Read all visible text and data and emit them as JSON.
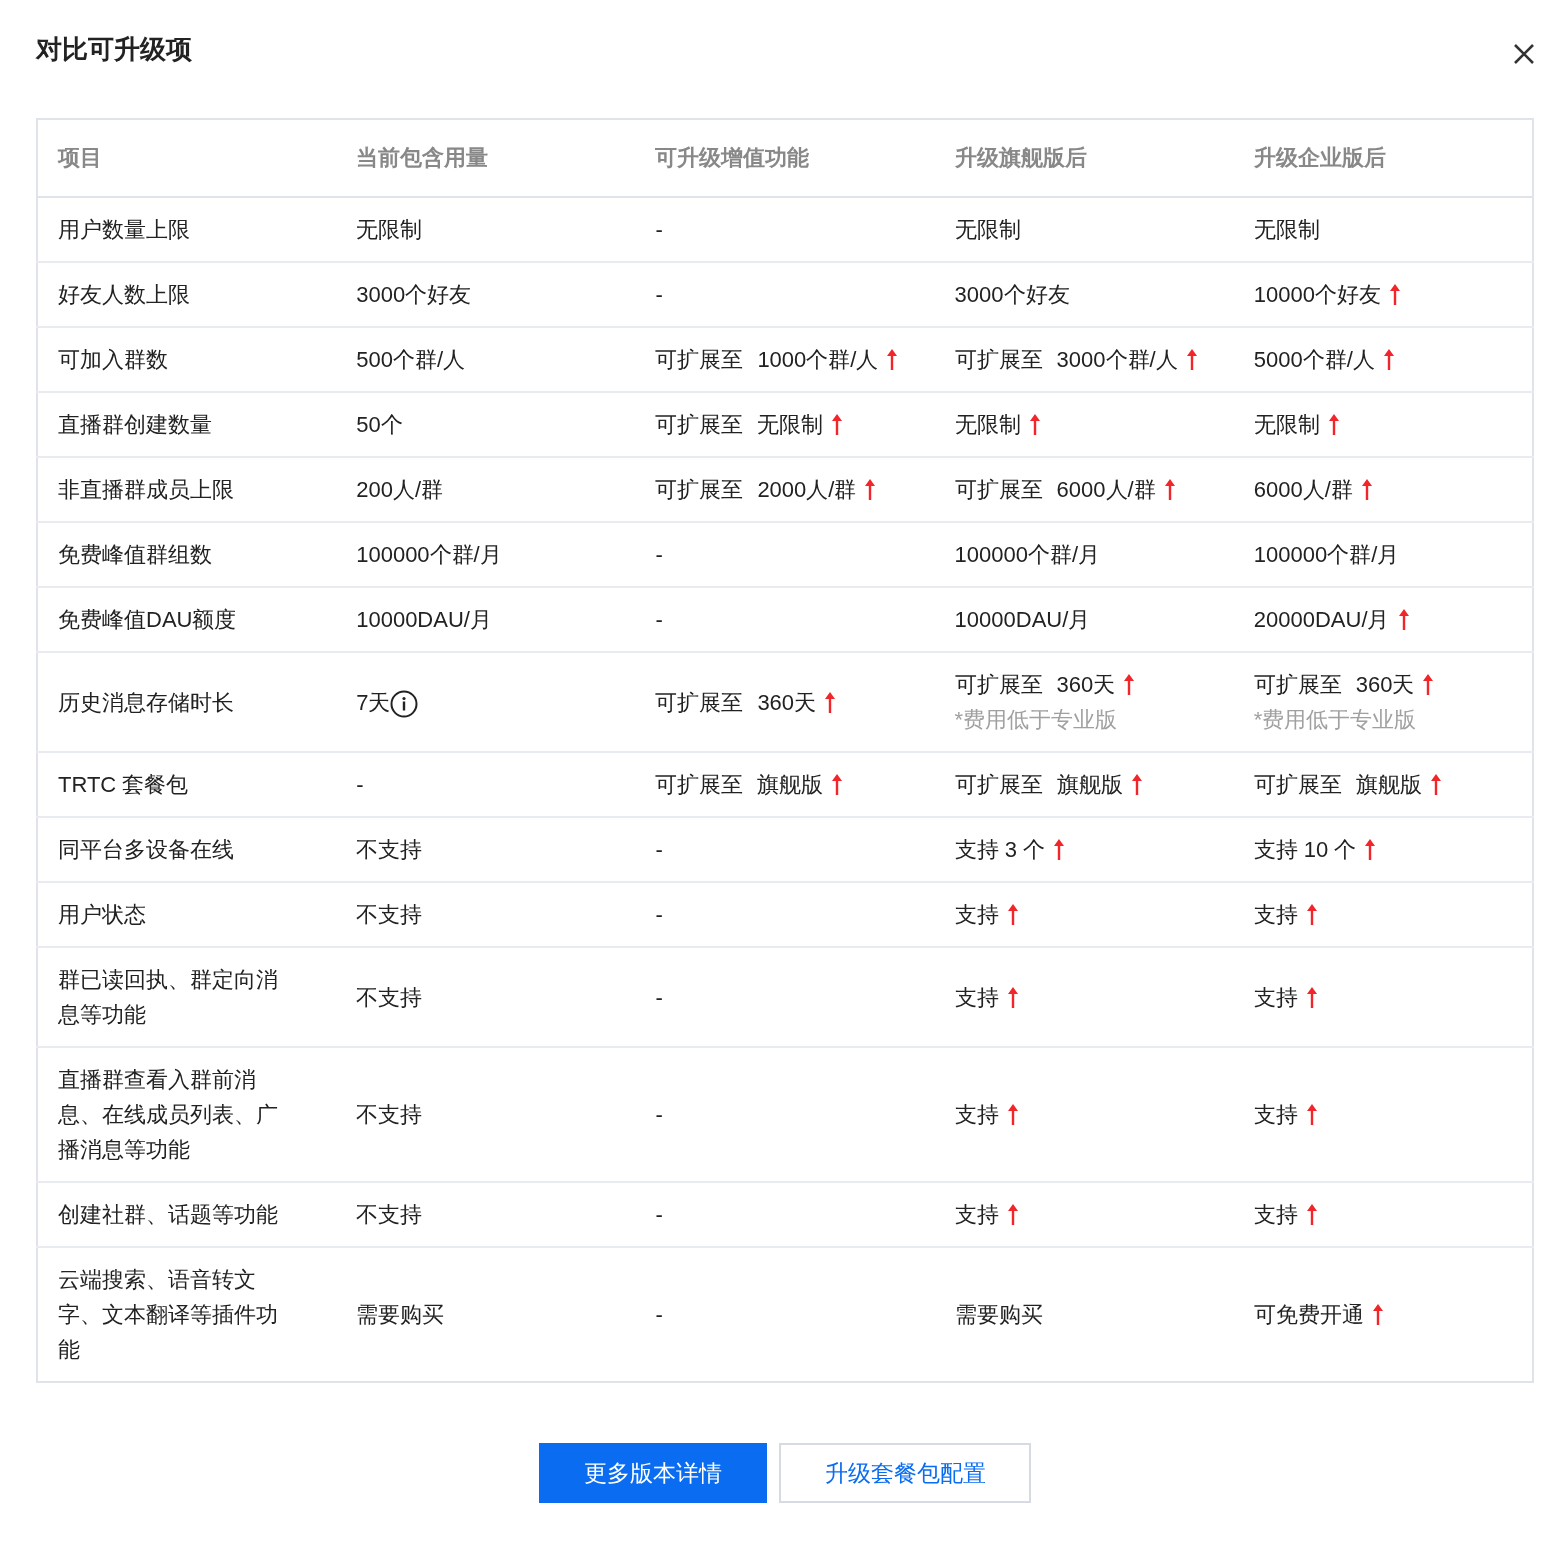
{
  "dialog": {
    "title": "对比可升级项"
  },
  "table": {
    "columns": [
      "项目",
      "当前包含用量",
      "可升级增值功能",
      "升级旗舰版后",
      "升级企业版后"
    ],
    "rows": [
      [
        {
          "text": "用户数量上限",
          "up": false
        },
        {
          "text": "无限制",
          "up": false
        },
        {
          "text": "-",
          "up": false
        },
        {
          "text": "无限制",
          "up": false
        },
        {
          "text": "无限制",
          "up": false
        }
      ],
      [
        {
          "text": "好友人数上限",
          "up": false
        },
        {
          "text": "3000个好友",
          "up": false
        },
        {
          "text": "-",
          "up": false
        },
        {
          "text": "3000个好友",
          "up": false
        },
        {
          "text": "10000个好友",
          "up": true
        }
      ],
      [
        {
          "text": "可加入群数",
          "up": false
        },
        {
          "text": "500个群/人",
          "up": false
        },
        {
          "prefix": "可扩展至",
          "text": "1000个群/人",
          "up": true
        },
        {
          "prefix": "可扩展至",
          "text": "3000个群/人",
          "up": true
        },
        {
          "text": "5000个群/人",
          "up": true
        }
      ],
      [
        {
          "text": "直播群创建数量",
          "up": false
        },
        {
          "text": "50个",
          "up": false
        },
        {
          "prefix": "可扩展至",
          "text": "无限制",
          "up": true
        },
        {
          "text": "无限制",
          "up": true
        },
        {
          "text": "无限制",
          "up": true
        }
      ],
      [
        {
          "text": "非直播群成员上限",
          "up": false
        },
        {
          "text": "200人/群",
          "up": false
        },
        {
          "prefix": "可扩展至",
          "text": "2000人/群",
          "up": true
        },
        {
          "prefix": "可扩展至",
          "text": "6000人/群",
          "up": true
        },
        {
          "text": "6000人/群",
          "up": true
        }
      ],
      [
        {
          "text": "免费峰值群组数",
          "up": false
        },
        {
          "text": "100000个群/月",
          "up": false
        },
        {
          "text": "-",
          "up": false
        },
        {
          "text": "100000个群/月",
          "up": false
        },
        {
          "text": "100000个群/月",
          "up": false
        }
      ],
      [
        {
          "text": "免费峰值DAU额度",
          "up": false
        },
        {
          "text": "10000DAU/月",
          "up": false
        },
        {
          "text": "-",
          "up": false
        },
        {
          "text": "10000DAU/月",
          "up": false
        },
        {
          "text": "20000DAU/月",
          "up": true
        }
      ],
      [
        {
          "text": "历史消息存储时长",
          "up": false
        },
        {
          "text": "7天",
          "up": false,
          "info": true
        },
        {
          "prefix": "可扩展至",
          "text": "360天",
          "up": true
        },
        {
          "prefix": "可扩展至",
          "text": "360天",
          "up": true,
          "note": "*费用低于专业版"
        },
        {
          "prefix": "可扩展至",
          "text": "360天",
          "up": true,
          "note": "*费用低于专业版"
        }
      ],
      [
        {
          "text": "TRTC 套餐包",
          "up": false
        },
        {
          "text": "-",
          "up": false
        },
        {
          "prefix": "可扩展至",
          "text": "旗舰版",
          "up": true
        },
        {
          "prefix": "可扩展至",
          "text": "旗舰版",
          "up": true
        },
        {
          "prefix": "可扩展至",
          "text": "旗舰版",
          "up": true
        }
      ],
      [
        {
          "text": "同平台多设备在线",
          "up": false
        },
        {
          "text": "不支持",
          "up": false
        },
        {
          "text": "-",
          "up": false
        },
        {
          "text": "支持 3 个",
          "up": true
        },
        {
          "text": "支持 10 个",
          "up": true
        }
      ],
      [
        {
          "text": "用户状态",
          "up": false
        },
        {
          "text": "不支持",
          "up": false
        },
        {
          "text": "-",
          "up": false
        },
        {
          "text": "支持",
          "up": true
        },
        {
          "text": "支持",
          "up": true
        }
      ],
      [
        {
          "text": "群已读回执、群定向消息等功能",
          "up": false
        },
        {
          "text": "不支持",
          "up": false
        },
        {
          "text": "-",
          "up": false
        },
        {
          "text": "支持",
          "up": true
        },
        {
          "text": "支持",
          "up": true
        }
      ],
      [
        {
          "text": "直播群查看入群前消息、在线成员列表、广播消息等功能",
          "up": false
        },
        {
          "text": "不支持",
          "up": false
        },
        {
          "text": "-",
          "up": false
        },
        {
          "text": "支持",
          "up": true
        },
        {
          "text": "支持",
          "up": true
        }
      ],
      [
        {
          "text": "创建社群、话题等功能",
          "up": false
        },
        {
          "text": "不支持",
          "up": false
        },
        {
          "text": "-",
          "up": false
        },
        {
          "text": "支持",
          "up": true
        },
        {
          "text": "支持",
          "up": true
        }
      ],
      [
        {
          "text": "云端搜索、语音转文字、文本翻译等插件功能",
          "up": false
        },
        {
          "text": "需要购买",
          "up": false
        },
        {
          "text": "-",
          "up": false
        },
        {
          "text": "需要购买",
          "up": false
        },
        {
          "text": "可免费开通",
          "up": true
        }
      ]
    ]
  },
  "buttons": [
    {
      "label": "更多版本详情",
      "kind": "primary"
    },
    {
      "label": "升级套餐包配置",
      "kind": "secondary"
    }
  ]
}
